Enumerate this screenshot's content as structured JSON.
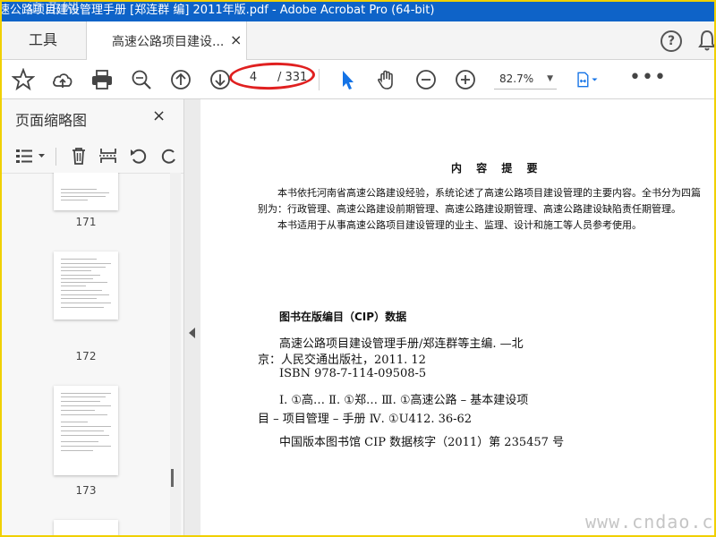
{
  "window": {
    "title": "速公路项目建设管理手册 [郑连群 编] 2011年版.pdf - Adobe Acrobat Pro (64-bit)",
    "watermark": "道游网"
  },
  "tabs": {
    "tools_label": "工具",
    "document_label": "高速公路项目建设...",
    "close_glyph": "×"
  },
  "toolbar": {
    "current_page": "4",
    "total_pages": "/ 331",
    "zoom": "82.7%",
    "more": "•••"
  },
  "left_panel": {
    "title": "页面缩略图",
    "close_glyph": "×",
    "thumbnails": [
      {
        "label": "171"
      },
      {
        "label": "172"
      },
      {
        "label": "173"
      }
    ]
  },
  "document": {
    "heading": "内 容 提 要",
    "summary_line1": "本书依托河南省高速公路建设经验，系统论述了高速公路项目建设管理的主要内容。全书分为四篇",
    "summary_line2": "别为：行政管理、高速公路建设前期管理、高速公路建设期管理、高速公路建设缺陷责任期管理。",
    "summary_line3": "本书适用于从事高速公路项目建设管理的业主、监理、设计和施工等人员参考使用。",
    "cip_title": "图书在版编目（CIP）数据",
    "cip_line1": "高速公路项目建设管理手册/郑连群等主编. —北",
    "cip_line2": "京：人民交通出版社，2011. 12",
    "cip_line3": "ISBN  978-7-114-09508-5",
    "cip_line4": "Ⅰ. ①高…   Ⅱ. ①郑…   Ⅲ. ①高速公路 – 基本建设项",
    "cip_line5": "目 – 项目管理 – 手册   Ⅳ. ①U412. 36-62",
    "cip_line6": "中国版本图书馆 CIP 数据核字（2011）第 235457 号",
    "watermark": "www.cndao.com"
  }
}
